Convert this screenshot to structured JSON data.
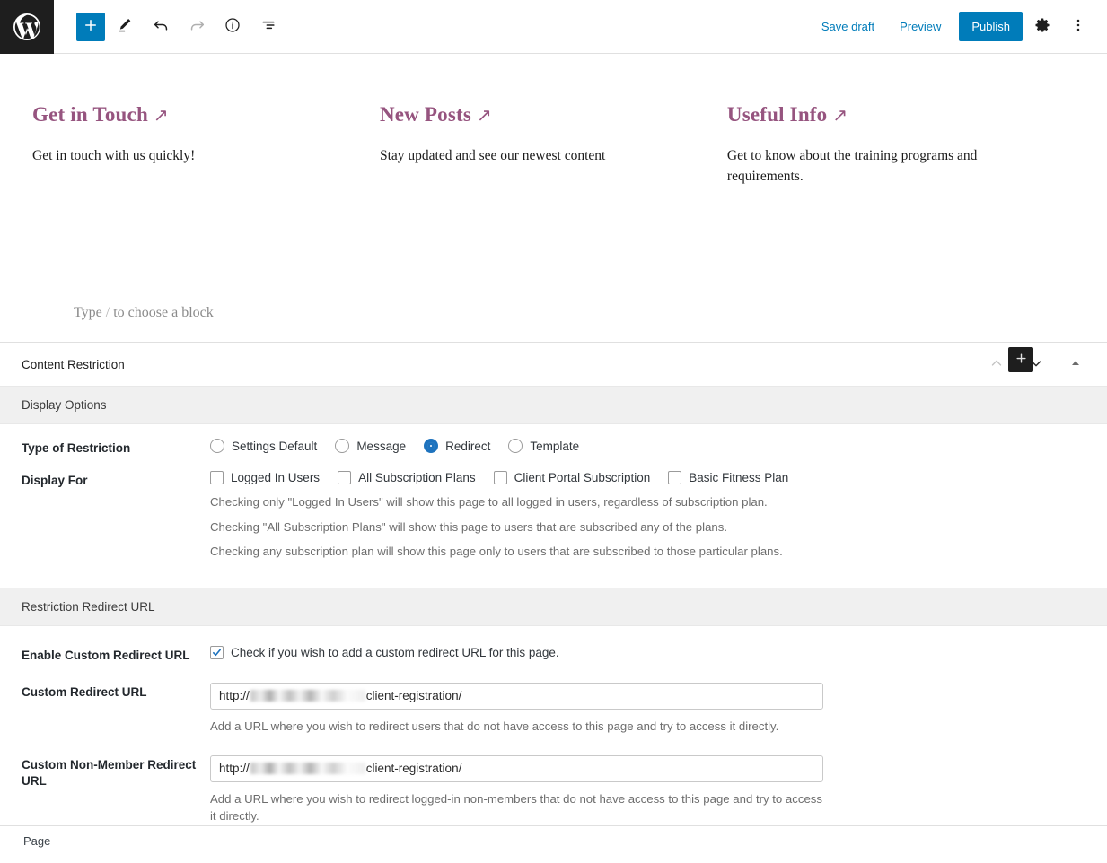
{
  "header": {
    "logo_icon": "wordpress-logo-icon",
    "tools": [
      {
        "name": "add-block-button",
        "icon": "plus-icon",
        "label": "Add block",
        "state": "primary"
      },
      {
        "name": "tools-pencil-button",
        "icon": "pencil-icon",
        "label": "Tools",
        "state": "default"
      },
      {
        "name": "undo-button",
        "icon": "undo-arrow-icon",
        "label": "Undo",
        "state": "default"
      },
      {
        "name": "redo-button",
        "icon": "redo-arrow-icon",
        "label": "Redo",
        "state": "disabled"
      },
      {
        "name": "details-button",
        "icon": "info-circle-icon",
        "label": "Details",
        "state": "default"
      },
      {
        "name": "list-view-button",
        "icon": "list-view-icon",
        "label": "List view",
        "state": "default"
      }
    ],
    "save_draft_label": "Save draft",
    "preview_label": "Preview",
    "publish_label": "Publish",
    "settings_icon": "gear-icon",
    "options_icon": "ellipsis-vertical-icon",
    "accent_color": "#007cba"
  },
  "canvas": {
    "columns": [
      {
        "heading": "Get in Touch",
        "heading_arrow": "↗",
        "text": "Get in touch with us quickly!"
      },
      {
        "heading": "New Posts",
        "heading_arrow": "↗",
        "text": "Stay updated and see our newest content"
      },
      {
        "heading": "Useful Info",
        "heading_arrow": "↗",
        "text": "Get to know about the training programs and requirements."
      }
    ],
    "heading_color": "#96547f",
    "placeholder_prefix": "Type",
    "placeholder_slash": "/",
    "placeholder_suffix": "to choose a block",
    "appender_icon": "plus-icon"
  },
  "metabox": {
    "title": "Content Restriction",
    "actions": [
      {
        "name": "move-up-button",
        "icon": "chevron-up-icon",
        "state": "disabled"
      },
      {
        "name": "move-down-button",
        "icon": "chevron-down-icon",
        "state": "default"
      },
      {
        "name": "collapse-toggle-button",
        "icon": "caret-up-icon",
        "state": "default"
      }
    ],
    "sections": {
      "display_options": {
        "bar_label": "Display Options",
        "type_of_restriction": {
          "label": "Type of Restriction",
          "options": [
            {
              "label": "Settings Default",
              "selected": false
            },
            {
              "label": "Message",
              "selected": false
            },
            {
              "label": "Redirect",
              "selected": true
            },
            {
              "label": "Template",
              "selected": false
            }
          ]
        },
        "display_for": {
          "label": "Display For",
          "options": [
            {
              "label": "Logged In Users",
              "checked": false
            },
            {
              "label": "All Subscription Plans",
              "checked": false
            },
            {
              "label": "Client Portal Subscription",
              "checked": false
            },
            {
              "label": "Basic Fitness Plan",
              "checked": false
            }
          ],
          "helpers": [
            "Checking only \"Logged In Users\" will show this page to all logged in users, regardless of subscription plan.",
            "Checking \"All Subscription Plans\" will show this page to users that are subscribed any of the plans.",
            "Checking any subscription plan will show this page only to users that are subscribed to those particular plans."
          ]
        }
      },
      "restriction_redirect_url": {
        "bar_label": "Restriction Redirect URL",
        "enable_custom_redirect": {
          "label": "Enable Custom Redirect URL",
          "checkbox_text": "Check if you wish to add a custom redirect URL for this page.",
          "checked": true
        },
        "custom_redirect_url": {
          "label": "Custom Redirect URL",
          "value_prefix": "http://",
          "value_redacted": true,
          "value_suffix": "client-registration/",
          "helper": "Add a URL where you wish to redirect users that do not have access to this page and try to access it directly."
        },
        "custom_non_member_redirect_url": {
          "label": "Custom Non-Member Redirect URL",
          "value_prefix": "http://",
          "value_redacted": true,
          "value_suffix": "client-registration/",
          "helper": "Add a URL where you wish to redirect logged-in non-members that do not have access to this page and try to access it directly."
        }
      }
    },
    "footer_label": "Page"
  }
}
